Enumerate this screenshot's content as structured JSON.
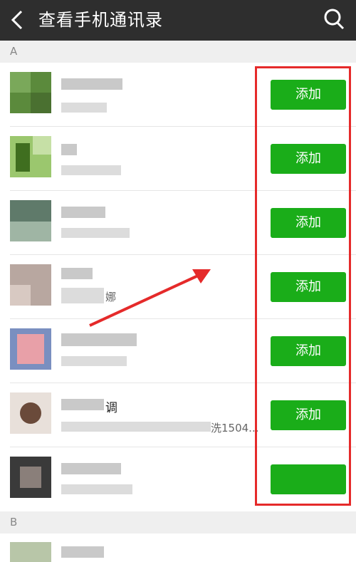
{
  "header": {
    "title": "查看手机通讯录",
    "back_icon": "back-arrow-icon",
    "search_icon": "search-icon",
    "background": "#2e2e2e"
  },
  "sections": [
    {
      "letter": "A"
    },
    {
      "letter": "B"
    }
  ],
  "rows": [
    {
      "name_fragment": "",
      "sub_fragment": "",
      "action": "添加"
    },
    {
      "name_fragment": "",
      "sub_fragment": "",
      "action": "添加"
    },
    {
      "name_fragment": "",
      "sub_fragment": "",
      "action": "添加"
    },
    {
      "name_fragment": "",
      "sub_fragment": "娜",
      "action": "添加"
    },
    {
      "name_fragment": "",
      "sub_fragment": "",
      "action": "添加"
    },
    {
      "name_fragment": "调",
      "sub_fragment": "洗1504...",
      "action": "添加"
    },
    {
      "name_fragment": "",
      "sub_fragment": "",
      "action": ""
    }
  ],
  "colors": {
    "accent": "#1aad19",
    "annotation": "#e52a2a"
  }
}
